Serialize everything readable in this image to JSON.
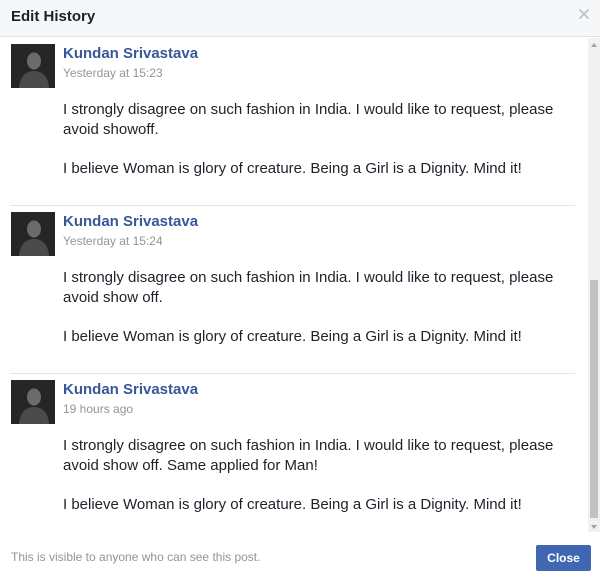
{
  "dialog": {
    "title": "Edit History",
    "close_icon": "close-icon"
  },
  "entries": [
    {
      "author": "Kundan Srivastava",
      "timestamp": "Yesterday at 15:23",
      "paragraphs": [
        "I strongly disagree on such fashion in India. I would like to request, please avoid showoff.",
        "I believe Woman is glory of creature. Being a Girl is a Dignity. Mind it!"
      ]
    },
    {
      "author": "Kundan Srivastava",
      "timestamp": "Yesterday at 15:24",
      "paragraphs": [
        "I strongly disagree on such fashion in India. I would like to request, please avoid show off.",
        "I believe Woman is glory of creature. Being a Girl is a Dignity. Mind it!"
      ]
    },
    {
      "author": "Kundan Srivastava",
      "timestamp": "19 hours ago",
      "paragraphs": [
        "I strongly disagree on such fashion in India. I would like to request, please avoid show off. Same applied for Man!",
        "I believe Woman is glory of creature. Being a Girl is a Dignity. Mind it!"
      ]
    }
  ],
  "footer": {
    "note": "This is visible to anyone who can see this post.",
    "close_label": "Close"
  },
  "colors": {
    "link": "#385898",
    "button": "#4267b2",
    "muted": "#90949c"
  }
}
